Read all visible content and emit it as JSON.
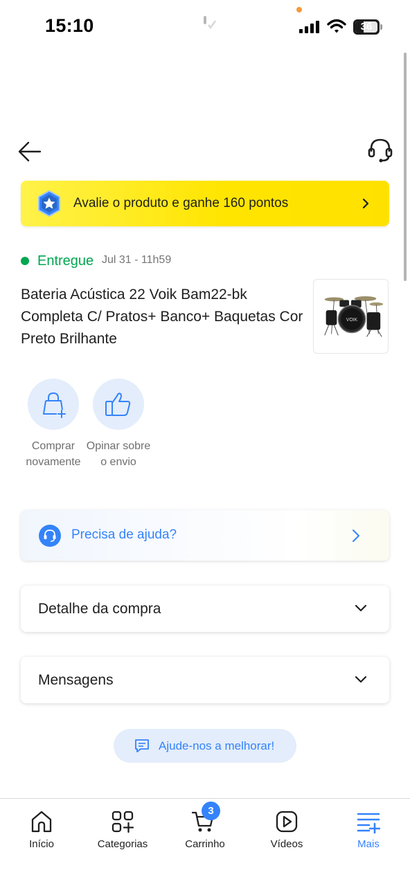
{
  "status_bar": {
    "time": "15:10",
    "battery_level": "36",
    "battery_fraction": 0.36
  },
  "header": {
    "back_icon": "arrow-left-icon",
    "support_icon": "headset-icon"
  },
  "points_banner": {
    "text": "Avalie o produto e ganhe 160 pontos",
    "icon": "star-medal-icon",
    "accent_color": "#ffe600"
  },
  "order": {
    "status": "Entregue",
    "date": "Jul 31 - 11h59",
    "status_color": "#00a650",
    "product_title": "Bateria Acústica 22 Voik Bam22-bk Completa C/ Pratos+ Banco+ Baquetas Cor Preto Brilhante",
    "thumbnail_brand": "VOIK"
  },
  "actions": [
    {
      "label": "Comprar novamente",
      "icon": "shopping-bag-plus-icon"
    },
    {
      "label": "Opinar sobre o envio",
      "icon": "thumbs-up-icon"
    }
  ],
  "help": {
    "text": "Precisa de ajuda?",
    "icon": "headset-icon",
    "accent_color": "#3483fa"
  },
  "sections": [
    {
      "title": "Detalhe da compra"
    },
    {
      "title": "Mensagens"
    }
  ],
  "feedback": {
    "text": "Ajude-nos a melhorar!",
    "icon": "chat-bubble-icon"
  },
  "bottom_nav": {
    "items": [
      {
        "label": "Início",
        "icon": "home-icon"
      },
      {
        "label": "Categorias",
        "icon": "grid-plus-icon"
      },
      {
        "label": "Carrinho",
        "icon": "cart-icon",
        "badge": "3"
      },
      {
        "label": "Vídeos",
        "icon": "play-icon"
      },
      {
        "label": "Mais",
        "icon": "menu-plus-icon",
        "active": true
      }
    ],
    "active_color": "#3483fa"
  }
}
